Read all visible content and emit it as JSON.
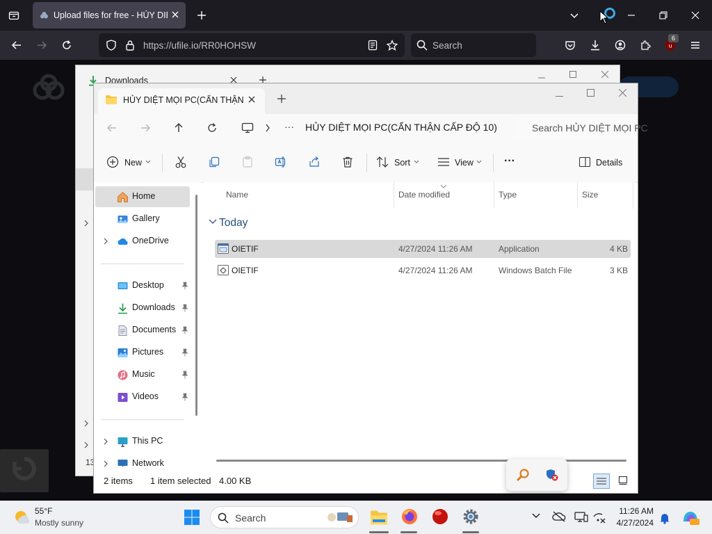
{
  "browser": {
    "tab_title": "Upload files for free - HỦY DIỆT",
    "url": "https://ufile.io/RR0HOHSW",
    "search_placeholder": "Search",
    "extension_badge": "6"
  },
  "back_window": {
    "tab_title": "Downloads",
    "sidebar_fragments": [
      "13"
    ]
  },
  "explorer": {
    "tab_title": "HỦY DIỆT MỌI PC(CẨN THẬN",
    "breadcrumb": "HỦY DIỆT MỌI PC(CẨN THẬN CẤP ĐỘ 10)",
    "breadcrumb_more": "···",
    "search_placeholder": "Search HỦY DIỆT MỌI PC",
    "commands": {
      "new": "New",
      "sort": "Sort",
      "view": "View",
      "more": "···",
      "details": "Details"
    },
    "nav": {
      "top": [
        {
          "label": "Home",
          "icon": "home-icon",
          "selected": true
        },
        {
          "label": "Gallery",
          "icon": "gallery-icon"
        },
        {
          "label": "OneDrive",
          "icon": "onedrive-icon",
          "expandable": true
        }
      ],
      "quick": [
        {
          "label": "Desktop",
          "icon": "desktop-icon"
        },
        {
          "label": "Downloads",
          "icon": "downloads-icon"
        },
        {
          "label": "Documents",
          "icon": "documents-icon"
        },
        {
          "label": "Pictures",
          "icon": "pictures-icon"
        },
        {
          "label": "Music",
          "icon": "music-icon"
        },
        {
          "label": "Videos",
          "icon": "videos-icon"
        }
      ],
      "bottom": [
        {
          "label": "This PC",
          "icon": "this-pc-icon"
        },
        {
          "label": "Network",
          "icon": "network-icon"
        }
      ]
    },
    "columns": {
      "name": "Name",
      "date": "Date modified",
      "type": "Type",
      "size": "Size"
    },
    "group": "Today",
    "files": [
      {
        "name": "OIETIF",
        "date": "4/27/2024 11:26 AM",
        "type": "Application",
        "size": "4 KB",
        "selected": true,
        "icon": "application-icon"
      },
      {
        "name": "OIETIF",
        "date": "4/27/2024 11:26 AM",
        "type": "Windows Batch File",
        "size": "3 KB",
        "selected": false,
        "icon": "batch-file-icon"
      }
    ],
    "status": {
      "items": "2 items",
      "selected": "1 item selected",
      "size": "4.00 KB"
    }
  },
  "taskbar": {
    "weather_temp": "55°F",
    "weather_desc": "Mostly sunny",
    "search_placeholder": "Search",
    "time": "11:26 AM",
    "date": "4/27/2024"
  },
  "colors": {
    "firefox_tabbar": "#1c1b22",
    "firefox_navbar": "#2b2a33",
    "explorer_bg": "#ffffff",
    "selection": "#d9d9d9",
    "accent": "#0067c0",
    "folder": "#f4c542"
  }
}
